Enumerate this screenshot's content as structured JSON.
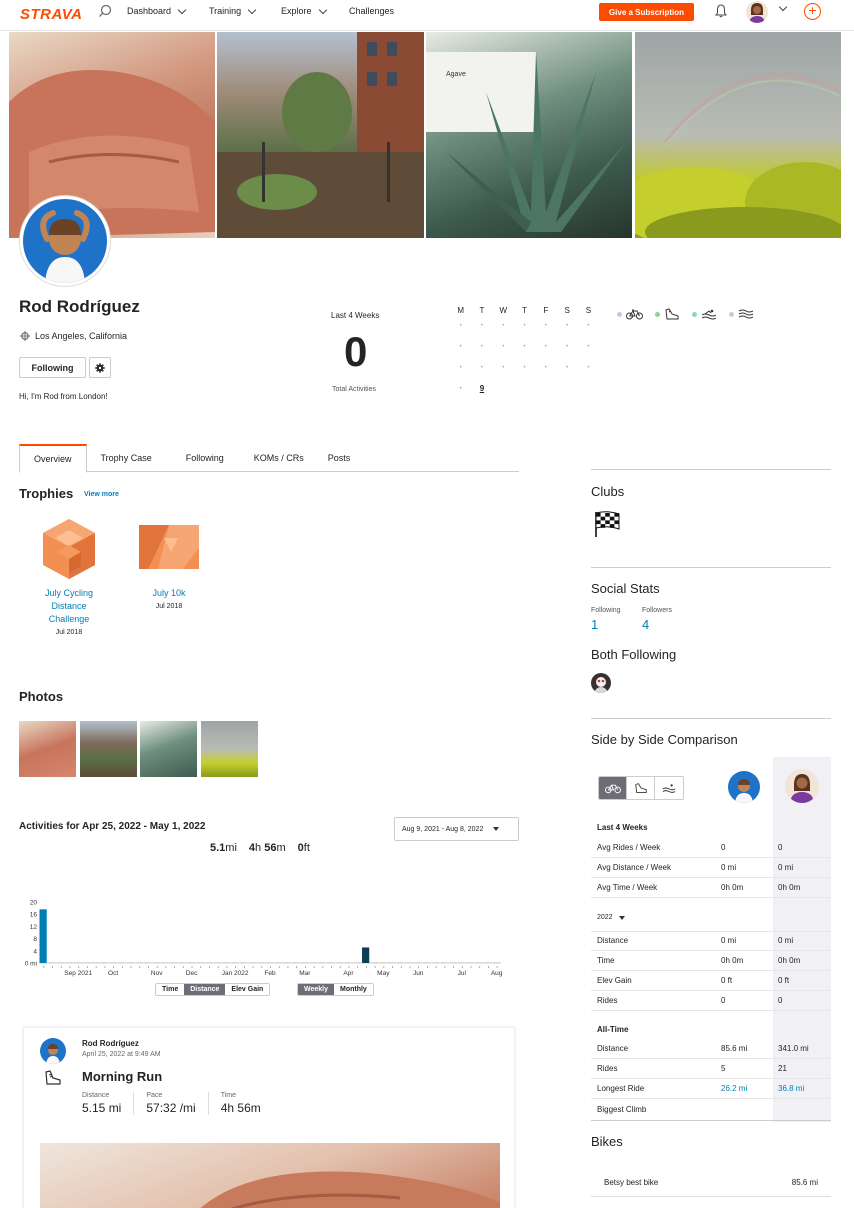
{
  "nav": {
    "logo": "STRAVA",
    "items": [
      "Dashboard",
      "Training",
      "Explore",
      "Challenges"
    ],
    "subscribe_label": "Give a Subscription"
  },
  "profile": {
    "name": "Rod Rodríguez",
    "location": "Los Angeles, California",
    "following_label": "Following",
    "bio": "Hi, I'm Rod from London!"
  },
  "last4": {
    "label": "Last 4 Weeks",
    "count": "0",
    "sub": "Total Activities"
  },
  "calendar": {
    "days": [
      "M",
      "T",
      "W",
      "T",
      "F",
      "S",
      "S"
    ],
    "today": "9"
  },
  "sport_filter_colors": [
    "#c8c8e0",
    "#8fd18f",
    "#8fd1c8",
    "#cccccc"
  ],
  "tabs": [
    "Overview",
    "Trophy Case",
    "Following",
    "KOMs / CRs",
    "Posts"
  ],
  "trophies": {
    "title": "Trophies",
    "view_more": "View more",
    "items": [
      {
        "label_lines": [
          "July Cycling",
          "Distance",
          "Challenge"
        ],
        "date": "Jul 2018"
      },
      {
        "label_lines": [
          "July 10k"
        ],
        "date": "Jul 2018"
      }
    ]
  },
  "photos": {
    "title": "Photos"
  },
  "activities": {
    "title": "Activities for Apr 25, 2022 - May 1, 2022",
    "date_range": "Aug 9, 2021 - Aug 8, 2022",
    "totals": [
      {
        "parts": [
          [
            "5.1",
            "b"
          ],
          [
            "mi",
            ""
          ]
        ]
      },
      {
        "parts": [
          [
            "4",
            "b"
          ],
          [
            "h ",
            ""
          ],
          [
            "56",
            "b"
          ],
          [
            "m",
            ""
          ]
        ]
      },
      {
        "parts": [
          [
            "0",
            "b"
          ],
          [
            "ft",
            ""
          ]
        ]
      }
    ],
    "metric_toggle": [
      "Time",
      "Distance",
      "Elev Gain"
    ],
    "metric_selected": "Distance",
    "period_toggle": [
      "Weekly",
      "Monthly"
    ],
    "period_selected": "Weekly"
  },
  "chart_data": {
    "type": "bar",
    "ylim": [
      0,
      20
    ],
    "yticks": [
      "20",
      "16",
      "12",
      "8",
      "4",
      "0 mi"
    ],
    "ytick_values": [
      20,
      16,
      12,
      8,
      4,
      0
    ],
    "x_labels": [
      {
        "index": 4,
        "label": "Sep 2021"
      },
      {
        "index": 8,
        "label": "Oct"
      },
      {
        "index": 13,
        "label": "Nov"
      },
      {
        "index": 17,
        "label": "Dec"
      },
      {
        "index": 22,
        "label": "Jan 2022"
      },
      {
        "index": 26,
        "label": "Feb"
      },
      {
        "index": 30,
        "label": "Mar"
      },
      {
        "index": 35,
        "label": "Apr"
      },
      {
        "index": 39,
        "label": "May"
      },
      {
        "index": 43,
        "label": "Jun"
      },
      {
        "index": 48,
        "label": "Jul"
      },
      {
        "index": 52,
        "label": "Aug"
      }
    ],
    "weeks": 53,
    "values": [
      17.6,
      0,
      0,
      0,
      0,
      0,
      0,
      0,
      0,
      0,
      0,
      0,
      0,
      0,
      0,
      0,
      0,
      0,
      0,
      0,
      0,
      0,
      0,
      0,
      0,
      0,
      0,
      0,
      0,
      0,
      0,
      0,
      0,
      0,
      0,
      0,
      0,
      5.1,
      0,
      0,
      0,
      0,
      0,
      0,
      0,
      0,
      0,
      0,
      0,
      0,
      0,
      0,
      0
    ],
    "highlight_index": 37,
    "bar_color": "#007fb6",
    "highlight_color": "#0d3e56"
  },
  "feed": {
    "athlete": "Rod Rodríguez",
    "date": "April 25, 2022 at 9:49 AM",
    "title": "Morning Run",
    "stats": [
      {
        "label": "Distance",
        "value": "5.15 mi"
      },
      {
        "label": "Pace",
        "value": "57:32 /mi"
      },
      {
        "label": "Time",
        "value": "4h 56m"
      }
    ]
  },
  "clubs": {
    "title": "Clubs"
  },
  "social": {
    "title": "Social Stats",
    "following_label": "Following",
    "following_count": "1",
    "followers_label": "Followers",
    "followers_count": "4",
    "both_title": "Both Following"
  },
  "comparison": {
    "title": "Side by Side Comparison",
    "last4_heading": "Last 4 Weeks",
    "last4_rows": [
      {
        "k": "Avg Rides / Week",
        "a": "0",
        "b": "0"
      },
      {
        "k": "Avg Distance / Week",
        "a": "0 mi",
        "b": "0 mi"
      },
      {
        "k": "Avg Time / Week",
        "a": "0h 0m",
        "b": "0h 0m"
      }
    ],
    "year": "2022",
    "year_rows": [
      {
        "k": "Distance",
        "a": "0 mi",
        "b": "0 mi"
      },
      {
        "k": "Time",
        "a": "0h 0m",
        "b": "0h 0m"
      },
      {
        "k": "Elev Gain",
        "a": "0 ft",
        "b": "0 ft"
      },
      {
        "k": "Rides",
        "a": "0",
        "b": "0"
      }
    ],
    "alltime_heading": "All-Time",
    "alltime_rows": [
      {
        "k": "Distance",
        "a": "85.6 mi",
        "b": "341.0 mi"
      },
      {
        "k": "Rides",
        "a": "5",
        "b": "21"
      },
      {
        "k": "Longest Ride",
        "a": "26.2 mi",
        "b": "36.8 mi",
        "link": true
      },
      {
        "k": "Biggest Climb",
        "a": "",
        "b": ""
      }
    ]
  },
  "bikes": {
    "title": "Bikes",
    "items": [
      {
        "name": "Betsy best bike",
        "distance": "85.6 mi"
      }
    ]
  }
}
